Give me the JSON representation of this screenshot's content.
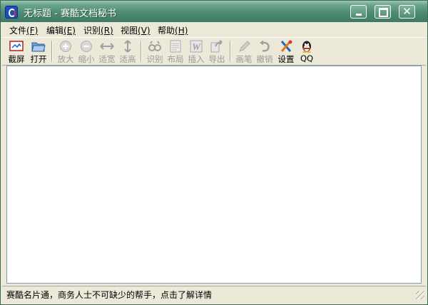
{
  "window": {
    "title": "无标题 - 赛酷文档秘书"
  },
  "menu": [
    {
      "label": "文件",
      "key": "(F)"
    },
    {
      "label": "编辑",
      "key": "(E)"
    },
    {
      "label": "识别",
      "key": "(R)"
    },
    {
      "label": "视图",
      "key": "(V)"
    },
    {
      "label": "帮助",
      "key": "(H)"
    }
  ],
  "toolbar": [
    {
      "label": "截屏",
      "icon": "screenshot-icon",
      "enabled": true
    },
    {
      "label": "打开",
      "icon": "open-folder-icon",
      "enabled": true
    },
    {
      "label": "放大",
      "icon": "zoom-in-icon",
      "enabled": false
    },
    {
      "label": "缩小",
      "icon": "zoom-out-icon",
      "enabled": false
    },
    {
      "label": "适宽",
      "icon": "fit-width-icon",
      "enabled": false
    },
    {
      "label": "适高",
      "icon": "fit-height-icon",
      "enabled": false
    },
    {
      "label": "识别",
      "icon": "recognize-icon",
      "enabled": false
    },
    {
      "label": "布局",
      "icon": "layout-icon",
      "enabled": false
    },
    {
      "label": "插入",
      "icon": "insert-word-icon",
      "enabled": false
    },
    {
      "label": "导出",
      "icon": "export-icon",
      "enabled": false
    },
    {
      "label": "画笔",
      "icon": "pen-icon",
      "enabled": false
    },
    {
      "label": "撤销",
      "icon": "undo-icon",
      "enabled": false
    },
    {
      "label": "设置",
      "icon": "settings-tools-icon",
      "enabled": true
    },
    {
      "label": "QQ",
      "icon": "qq-penguin-icon",
      "enabled": true
    }
  ],
  "status": {
    "text": "赛酷名片通，商务人士不可缺少的帮手，点击了解详情"
  },
  "colors": {
    "titlebar": "#4e8a74",
    "chrome": "#ece9d8",
    "disabled_text": "#9b9b9b"
  }
}
